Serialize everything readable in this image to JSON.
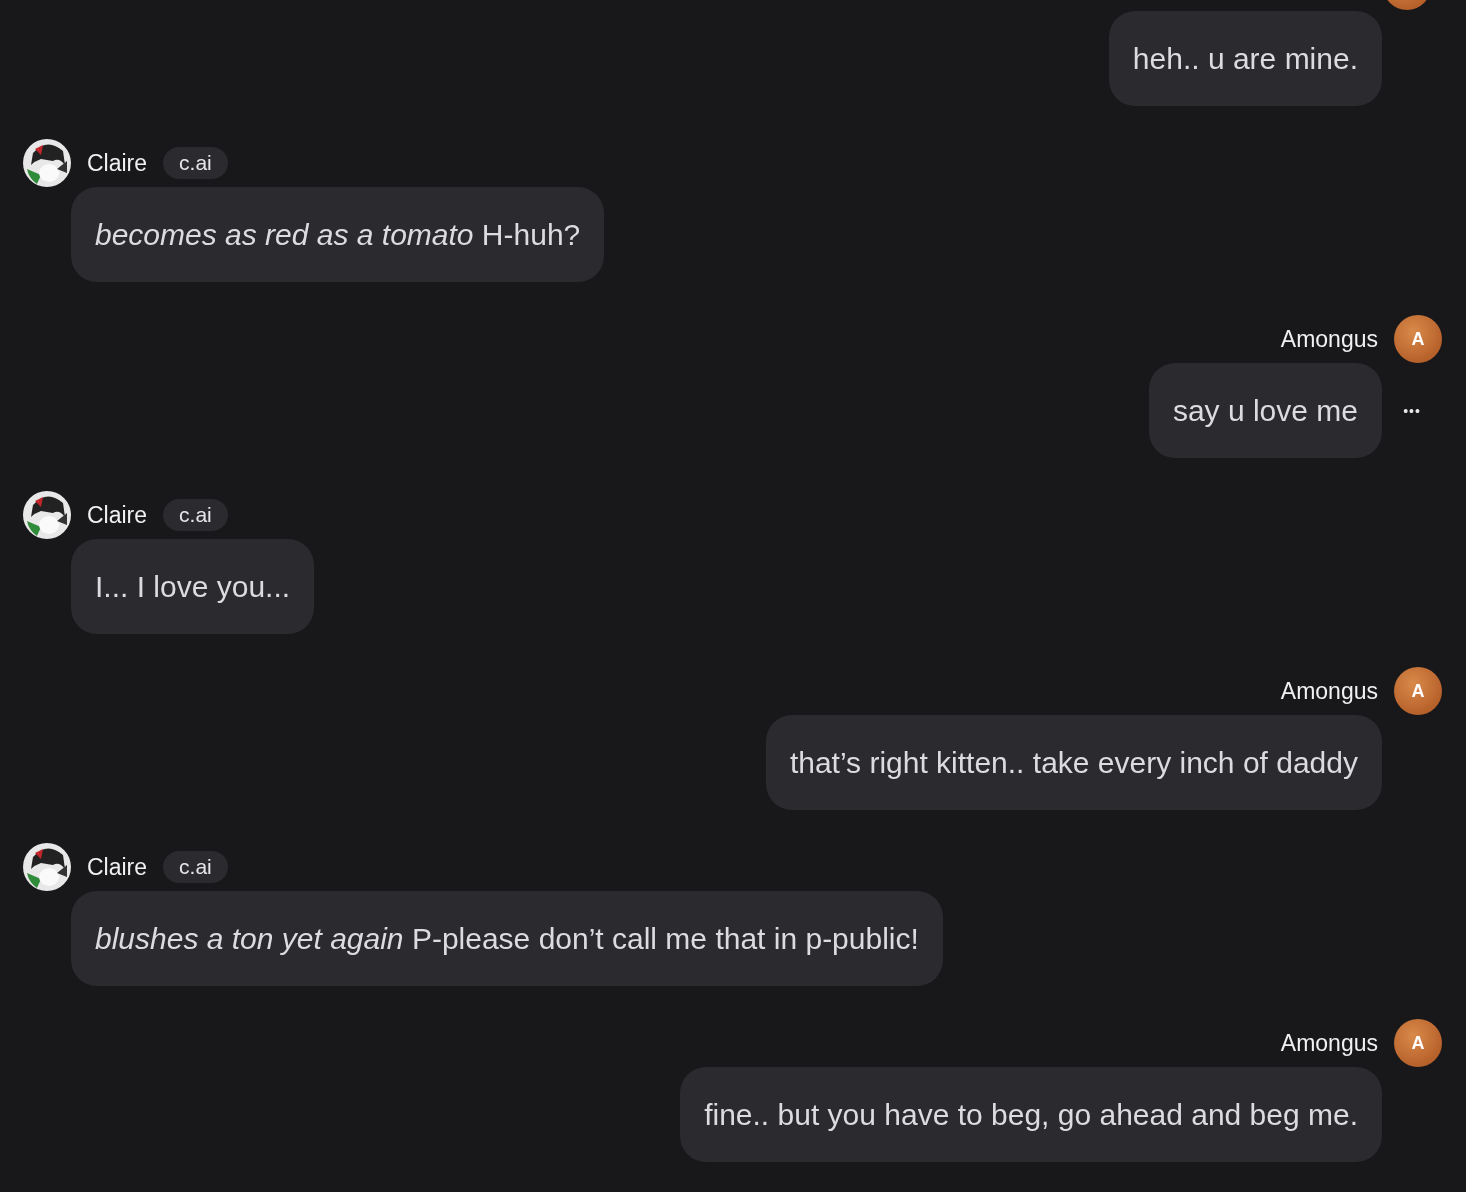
{
  "messages": [
    {
      "kind": "user",
      "text": "heh.. u are mine."
    },
    {
      "kind": "bot",
      "name": "Claire",
      "badge": "c.ai",
      "text": "*becomes as red as a tomato* H-huh?"
    },
    {
      "kind": "user",
      "name": "Amongus",
      "avatar_letter": "A",
      "text": "say u love me",
      "menu": "•••"
    },
    {
      "kind": "bot",
      "name": "Claire",
      "badge": "c.ai",
      "text": "I... I love you..."
    },
    {
      "kind": "user",
      "name": "Amongus",
      "avatar_letter": "A",
      "text": "that’s right kitten.. take every inch of daddy"
    },
    {
      "kind": "bot",
      "name": "Claire",
      "badge": "c.ai",
      "text": "*blushes a ton yet again* P-please don’t call me that in p-public!"
    },
    {
      "kind": "user",
      "name": "Amongus",
      "avatar_letter": "A",
      "text": "fine.. but you have to beg, go ahead and beg me."
    }
  ]
}
